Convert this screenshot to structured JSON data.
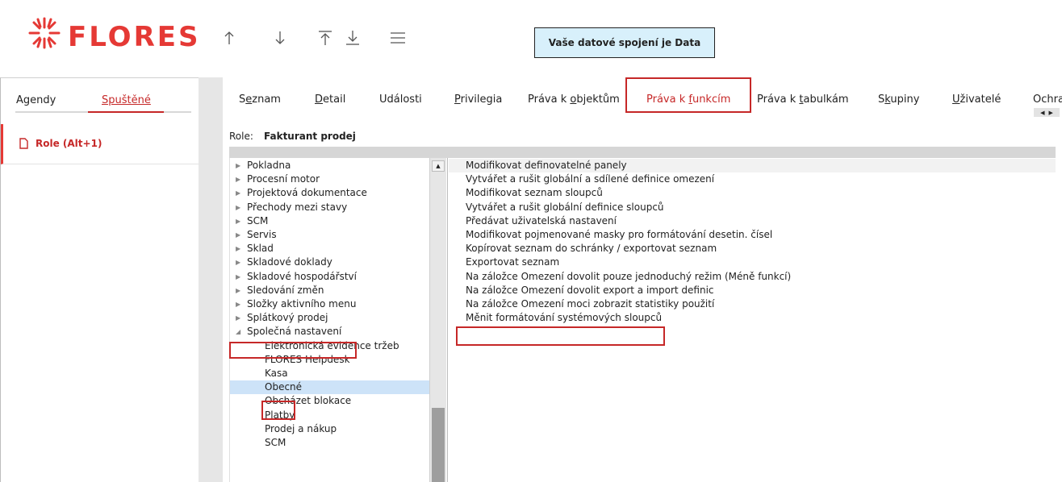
{
  "app": {
    "brand": "FLORES",
    "connection_text": "Vaše datové spojení je Data",
    "toolbar_icons": [
      "arrow-up-icon",
      "arrow-down-icon",
      "move-top-icon",
      "move-bottom-icon",
      "menu-icon"
    ]
  },
  "left_panel": {
    "tabs": [
      {
        "label": "Agendy",
        "active": false
      },
      {
        "label": "Spuštěné",
        "active": true
      }
    ],
    "open_item": "Role (Alt+1)"
  },
  "tabs": [
    {
      "pre": "S",
      "u": "e",
      "post": "znam",
      "active": false
    },
    {
      "pre": "",
      "u": "D",
      "post": "etail",
      "active": false
    },
    {
      "pre": "Události",
      "u": "",
      "post": "",
      "active": false
    },
    {
      "pre": "",
      "u": "P",
      "post": "rivilegia",
      "active": false
    },
    {
      "pre": "Práva k ",
      "u": "o",
      "post": "bjektům",
      "active": false
    },
    {
      "pre": "Práva k ",
      "u": "f",
      "post": "unkcím",
      "active": true
    },
    {
      "pre": "Práva k ",
      "u": "t",
      "post": "abulkám",
      "active": false
    },
    {
      "pre": "S",
      "u": "k",
      "post": "upiny",
      "active": false
    },
    {
      "pre": "",
      "u": "U",
      "post": "živatelé",
      "active": false
    },
    {
      "pre": "Ochra",
      "u": "",
      "post": "",
      "active": false
    }
  ],
  "role": {
    "label": "Role:",
    "value": "Fakturant prodej"
  },
  "tree": [
    {
      "label": "Pokladna",
      "level": 0,
      "expanded": false
    },
    {
      "label": "Procesní motor",
      "level": 0,
      "expanded": false
    },
    {
      "label": "Projektová dokumentace",
      "level": 0,
      "expanded": false
    },
    {
      "label": "Přechody mezi stavy",
      "level": 0,
      "expanded": false
    },
    {
      "label": "SCM",
      "level": 0,
      "expanded": false
    },
    {
      "label": "Servis",
      "level": 0,
      "expanded": false
    },
    {
      "label": "Sklad",
      "level": 0,
      "expanded": false
    },
    {
      "label": "Skladové doklady",
      "level": 0,
      "expanded": false
    },
    {
      "label": "Skladové hospodářství",
      "level": 0,
      "expanded": false
    },
    {
      "label": "Sledování změn",
      "level": 0,
      "expanded": false
    },
    {
      "label": "Složky aktivního menu",
      "level": 0,
      "expanded": false
    },
    {
      "label": "Splátkový prodej",
      "level": 0,
      "expanded": false
    },
    {
      "label": "Společná nastavení",
      "level": 0,
      "expanded": true
    },
    {
      "label": "Elektronická evidence tržeb",
      "level": 1
    },
    {
      "label": "FLORES Helpdesk",
      "level": 1
    },
    {
      "label": "Kasa",
      "level": 1
    },
    {
      "label": "Obecné",
      "level": 1,
      "selected": true
    },
    {
      "label": "Obcházet blokace",
      "level": 1
    },
    {
      "label": "Platby",
      "level": 1
    },
    {
      "label": "Prodej a nákup",
      "level": 1
    },
    {
      "label": "SCM",
      "level": 1
    }
  ],
  "functions": [
    "Modifikovat definovatelné panely",
    "Vytvářet a rušit globální a sdílené definice omezení",
    "Modifikovat seznam sloupců",
    "Vytvářet a rušit globální definice sloupců",
    "Předávat uživatelská nastavení",
    "Modifikovat pojmenované masky pro formátování desetin. čísel",
    "Kopírovat seznam do schránky / exportovat seznam",
    "Exportovat seznam",
    "Na záložce Omezení dovolit pouze jednoduchý režim (Méně funkcí)",
    "Na záložce Omezení dovolit export a import definic",
    "Na záložce Omezení moci zobrazit statistiky použití",
    "Měnit formátování systémových sloupců"
  ],
  "colors": {
    "brand": "#e53935",
    "accent": "#c62828",
    "connection_bg": "#d8f0fb",
    "selection": "#cde3f8"
  }
}
